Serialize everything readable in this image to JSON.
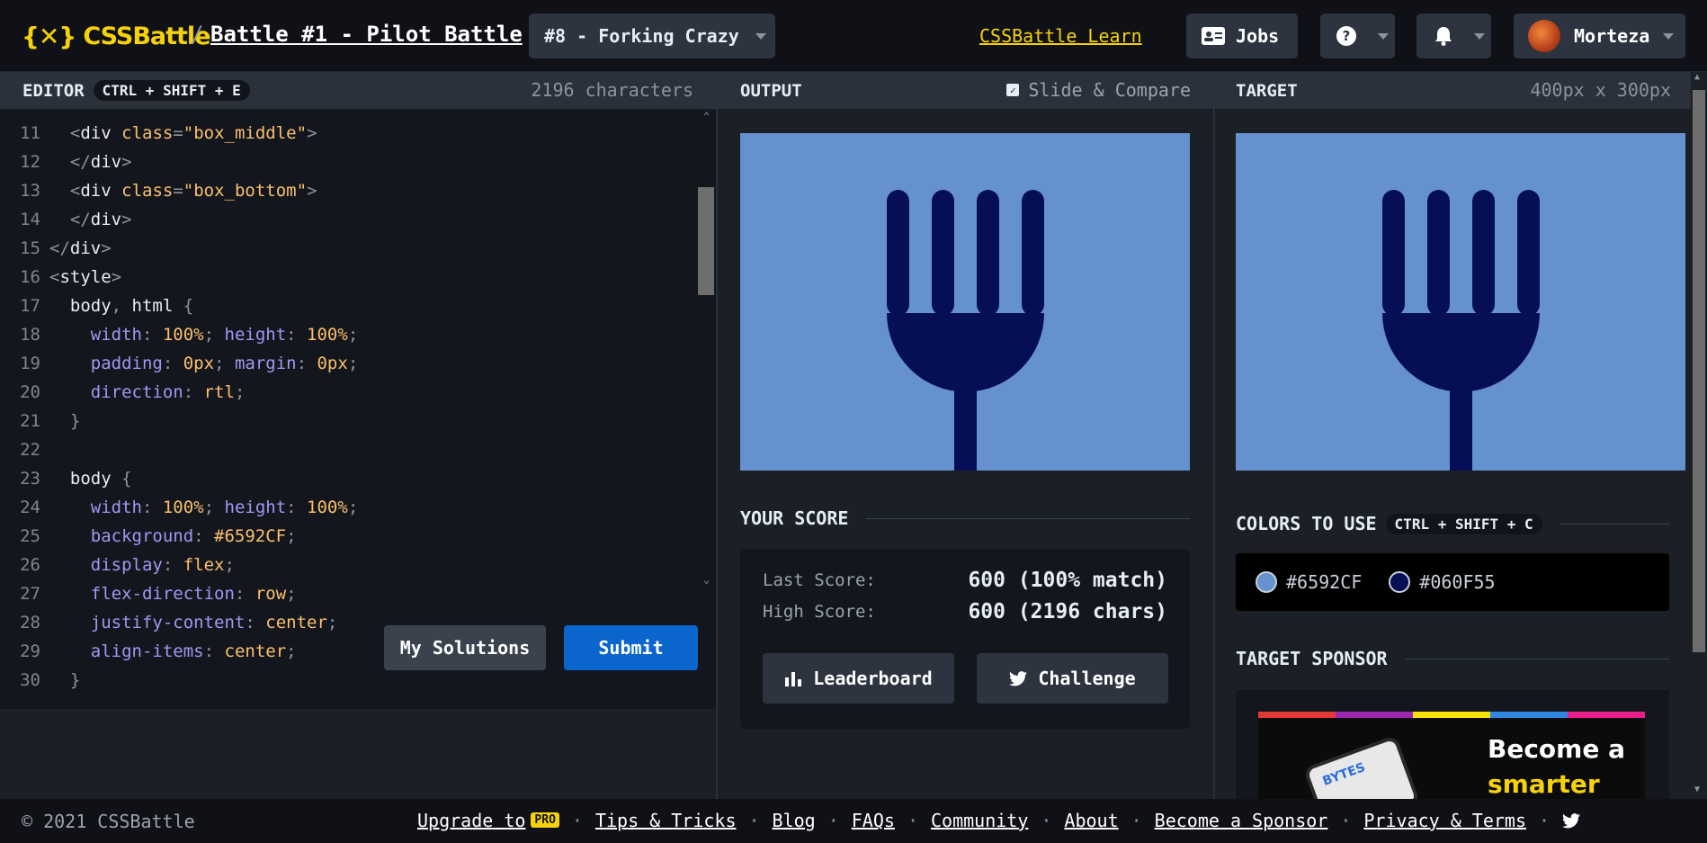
{
  "header": {
    "logo_mark": "{✕}",
    "logo_text": "CSSBattle",
    "separator": "/",
    "battle_title": "Battle #1 - Pilot Battle",
    "challenge_select": "#8 - Forking Crazy",
    "learn_link": "CSSBattle Learn",
    "jobs_label": "Jobs",
    "user_name": "Morteza"
  },
  "editor": {
    "title": "EDITOR",
    "shortcut": "CTRL + SHIFT + E",
    "char_count": "2196 characters",
    "lines": [
      {
        "n": "11"
      },
      {
        "n": "12"
      },
      {
        "n": "13"
      },
      {
        "n": "14"
      },
      {
        "n": "15"
      },
      {
        "n": "16"
      },
      {
        "n": "17"
      },
      {
        "n": "18"
      },
      {
        "n": "19"
      },
      {
        "n": "20"
      },
      {
        "n": "21"
      },
      {
        "n": "22"
      },
      {
        "n": "23"
      },
      {
        "n": "24"
      },
      {
        "n": "25"
      },
      {
        "n": "26"
      },
      {
        "n": "27"
      },
      {
        "n": "28"
      },
      {
        "n": "29"
      },
      {
        "n": "30"
      }
    ],
    "code": {
      "l11_tag": "div",
      "l11_attr": "class",
      "l11_val": "\"box_middle\"",
      "l12_tag": "div",
      "l13_tag": "div",
      "l13_attr": "class",
      "l13_val": "\"box_bottom\"",
      "l14_tag": "div",
      "l15_tag": "div",
      "l16_tag": "style",
      "l17_sel1": "body",
      "l17_sel2": "html",
      "l18_p1": "width",
      "l18_v1": "100%",
      "l18_p2": "height",
      "l18_v2": "100%",
      "l19_p1": "padding",
      "l19_v1": "0px",
      "l19_p2": "margin",
      "l19_v2": "0px",
      "l20_p": "direction",
      "l20_v": "rtl",
      "l23_sel": "body",
      "l24_p1": "width",
      "l24_v1": "100%",
      "l24_p2": "height",
      "l24_v2": "100%",
      "l25_p": "background",
      "l25_v": "#6592CF",
      "l26_p": "display",
      "l26_v": "flex",
      "l27_p": "flex-direction",
      "l27_v": "row",
      "l28_p": "justify-content",
      "l28_v": "center",
      "l29_p": "align-items",
      "l29_v": "center"
    },
    "my_solutions_label": "My Solutions",
    "submit_label": "Submit"
  },
  "output": {
    "title": "OUTPUT",
    "compare_label": "Slide & Compare",
    "compare_checked": true
  },
  "score": {
    "title": "YOUR SCORE",
    "last_label": "Last Score:",
    "last_value": "600 (100% match)",
    "high_label": "High Score:",
    "high_value": "600 (2196 chars)",
    "leaderboard_label": "Leaderboard",
    "challenge_label": "Challenge"
  },
  "target": {
    "title": "TARGET",
    "dims": "400px x 300px",
    "colors_title": "COLORS TO USE",
    "colors_shortcut": "CTRL + SHIFT + C",
    "colors": [
      {
        "hex": "#6592CF",
        "value": "#6592CF"
      },
      {
        "hex": "#060F55",
        "value": "#060F55"
      }
    ],
    "sponsor_title": "TARGET SPONSOR",
    "sponsor_line1": "Become a",
    "sponsor_line2": "smarter",
    "sponsor_phone_text": "BYTES"
  },
  "footer": {
    "copyright": "© 2021 CSSBattle",
    "upgrade": "Upgrade to",
    "pro_badge": "PRO",
    "links": [
      "Tips & Tricks",
      "Blog",
      "FAQs",
      "Community",
      "About",
      "Become a Sponsor",
      "Privacy & Terms"
    ],
    "dot": "·"
  },
  "colors": {
    "accent": "#f5d20a",
    "submit": "#0a66cc",
    "canvas_bg": "#6592CF",
    "fork": "#060F55"
  }
}
